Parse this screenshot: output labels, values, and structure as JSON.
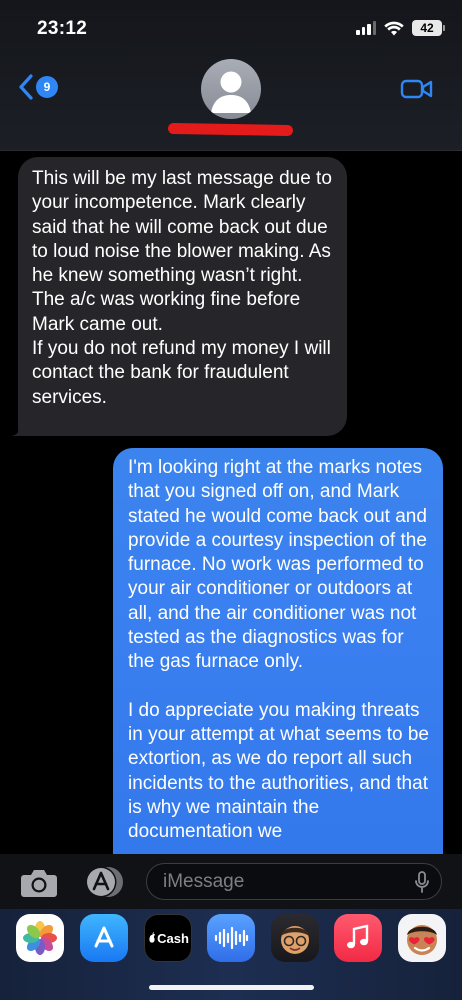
{
  "status_bar": {
    "time": "23:12",
    "battery": "42",
    "icons": [
      "signal-icon",
      "wifi-icon",
      "battery-icon"
    ]
  },
  "header": {
    "back_badge": "9",
    "contact_name": "",
    "icons": [
      "chevron-left-icon",
      "contact-avatar-icon",
      "video-camera-icon"
    ]
  },
  "messages": [
    {
      "direction": "incoming",
      "text": "This will be my last message due to your incompetence. Mark clearly said that he will come back out due to loud noise the blower making. As he knew something wasn’t right. The a/c was working fine before Mark came out.\nIf you do not refund my money I will contact the bank for fraudulent services."
    },
    {
      "direction": "outgoing",
      "paragraphs": [
        "I'm looking right at the marks notes that you signed off on, and Mark stated he would come back out and provide a courtesy inspection of the furnace. No work was performed to your air conditioner or outdoors at all, and the air conditioner was not tested as the diagnostics was for the gas furnace only.",
        "I do appreciate you making threats in your attempt at what seems to be extortion, as we do report all such incidents to the authorities, and that is why we maintain the documentation we"
      ]
    }
  ],
  "input_bar": {
    "placeholder": "iMessage",
    "icons": [
      "camera-icon",
      "apps-icon",
      "microphone-icon"
    ]
  },
  "app_drawer": {
    "apps": [
      {
        "name": "photos-app-icon"
      },
      {
        "name": "app-store-icon"
      },
      {
        "name": "cash-app-icon",
        "label": "Cash"
      },
      {
        "name": "audio-message-icon"
      },
      {
        "name": "memoji-icon"
      },
      {
        "name": "music-app-icon"
      },
      {
        "name": "memoji-stickers-icon"
      }
    ]
  },
  "colors": {
    "outgoing_bubble": "#3a7ff0",
    "incoming_bubble": "#26262a",
    "accent": "#2f87f6"
  }
}
